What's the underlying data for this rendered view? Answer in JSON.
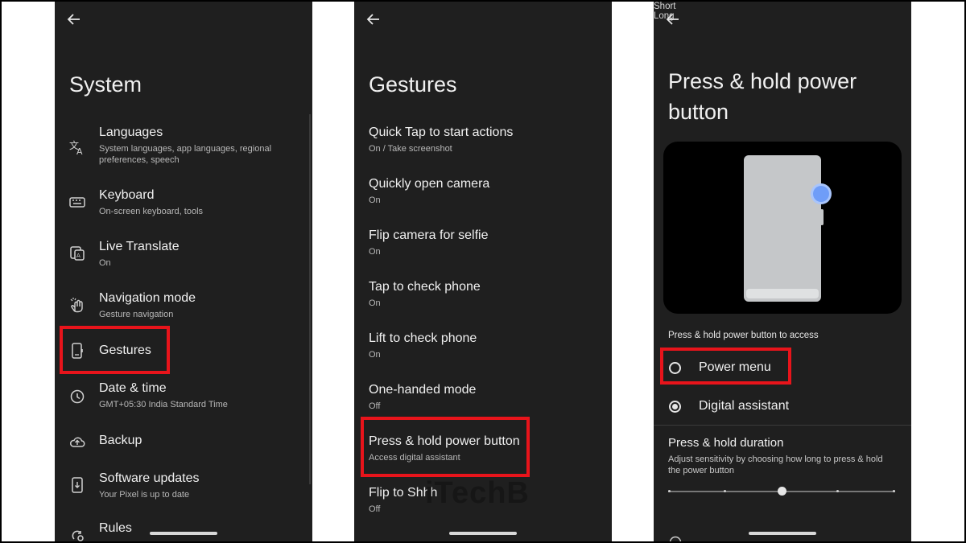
{
  "panel1": {
    "title": "System",
    "items": [
      {
        "label": "Languages",
        "sub": "System languages, app languages, regional preferences, speech",
        "icon": "translate-icon"
      },
      {
        "label": "Keyboard",
        "sub": "On-screen keyboard, tools",
        "icon": "keyboard-icon"
      },
      {
        "label": "Live Translate",
        "sub": "On",
        "icon": "live-translate-icon"
      },
      {
        "label": "Navigation mode",
        "sub": "Gesture navigation",
        "icon": "gesture-hand-icon"
      },
      {
        "label": "Gestures",
        "sub": "",
        "icon": "phone-gesture-icon"
      },
      {
        "label": "Date & time",
        "sub": "GMT+05:30 India Standard Time",
        "icon": "clock-icon"
      },
      {
        "label": "Backup",
        "sub": "",
        "icon": "cloud-upload-icon"
      },
      {
        "label": "Software updates",
        "sub": "Your Pixel is up to date",
        "icon": "system-update-icon"
      },
      {
        "label": "Rules",
        "sub": "",
        "icon": "rules-icon"
      }
    ]
  },
  "panel2": {
    "title": "Gestures",
    "items": [
      {
        "label": "Quick Tap to start actions",
        "sub": "On / Take screenshot"
      },
      {
        "label": "Quickly open camera",
        "sub": "On"
      },
      {
        "label": "Flip camera for selfie",
        "sub": "On"
      },
      {
        "label": "Tap to check phone",
        "sub": "On"
      },
      {
        "label": "Lift to check phone",
        "sub": "On"
      },
      {
        "label": "One-handed mode",
        "sub": "Off"
      },
      {
        "label": "Press & hold power button",
        "sub": "Access digital assistant"
      },
      {
        "label": "Flip to Shhh",
        "sub": "Off"
      }
    ]
  },
  "panel3": {
    "title_line1": "Press & hold power",
    "title_line2": "button",
    "section_label": "Press & hold power button to access",
    "options": [
      {
        "label": "Power menu",
        "selected": false
      },
      {
        "label": "Digital assistant",
        "selected": true
      }
    ],
    "duration_title": "Press & hold duration",
    "duration_sub": "Adjust sensitivity by choosing how long to press & hold the power button",
    "slider_min_label": "Short",
    "slider_max_label": "Long",
    "slider_value_fraction": 0.5
  },
  "watermark": "iTechB",
  "colors": {
    "background": "#1f1f1f",
    "highlight": "#e8141b",
    "accent_blue": "#6f9df8"
  }
}
